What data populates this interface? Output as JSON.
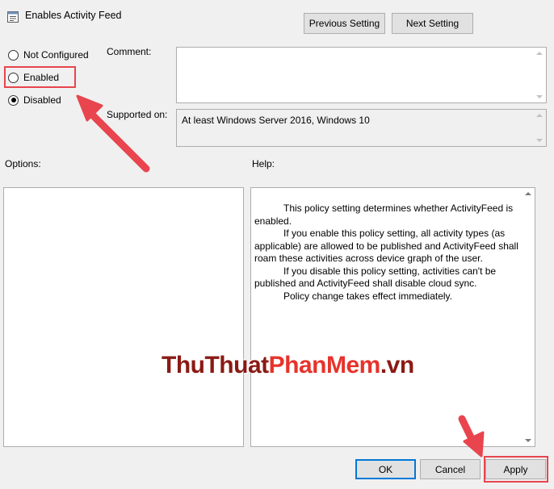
{
  "window": {
    "title": "Enables Activity Feed"
  },
  "nav": {
    "previous": "Previous Setting",
    "next": "Next Setting"
  },
  "state": {
    "options": [
      {
        "id": "not-configured",
        "label": "Not Configured",
        "checked": false
      },
      {
        "id": "enabled",
        "label": "Enabled",
        "checked": false
      },
      {
        "id": "disabled",
        "label": "Disabled",
        "checked": true
      }
    ]
  },
  "comment": {
    "label": "Comment:",
    "value": ""
  },
  "supported": {
    "label": "Supported on:",
    "value": "At least Windows Server 2016, Windows 10"
  },
  "panels": {
    "options_label": "Options:",
    "help_label": "Help:"
  },
  "help": {
    "paragraphs": [
      "This policy setting determines whether ActivityFeed is enabled.",
      "If you enable this policy setting, all activity types (as applicable) are allowed to be published and ActivityFeed shall roam these activities across device graph of the user.",
      "If you disable this policy setting, activities can't be published and ActivityFeed shall disable cloud sync.",
      "Policy change takes effect immediately."
    ]
  },
  "footer": {
    "ok": "OK",
    "cancel": "Cancel",
    "apply": "Apply"
  },
  "watermark": {
    "part1": "ThuThuat",
    "part2": "PhanMem",
    "part3": ".vn"
  },
  "colors": {
    "annotation": "#e8454e",
    "watermark_dark": "#8b1a14",
    "watermark_red": "#e7332b",
    "focus": "#0078d7"
  }
}
